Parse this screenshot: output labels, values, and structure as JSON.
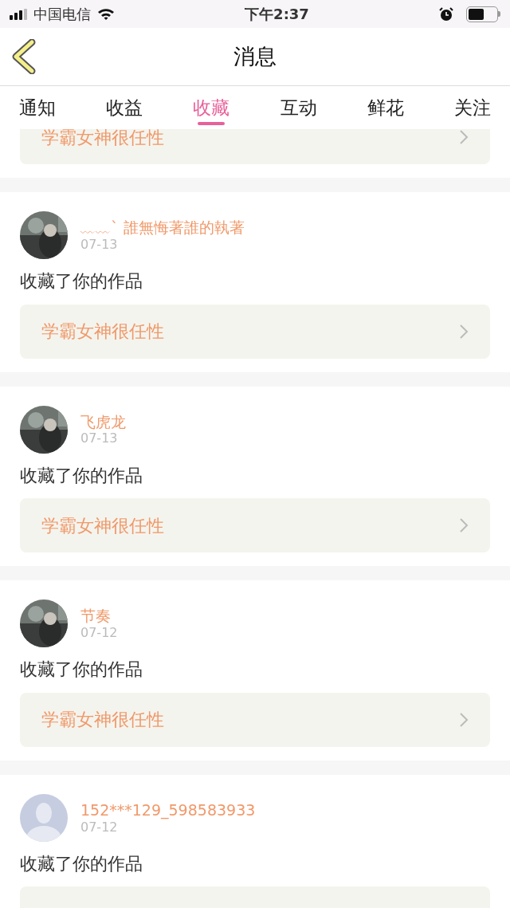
{
  "status_bar": {
    "carrier": "中国电信",
    "time": "下午2:37"
  },
  "nav": {
    "title": "消息"
  },
  "tabs": [
    {
      "label": "通知",
      "selected": false
    },
    {
      "label": "收益",
      "selected": false
    },
    {
      "label": "收藏",
      "selected": true
    },
    {
      "label": "互动",
      "selected": false
    },
    {
      "label": "鲜花",
      "selected": false
    },
    {
      "label": "关注",
      "selected": false
    }
  ],
  "partial_item": {
    "work_title": "学霸女神很任性"
  },
  "items": [
    {
      "name": "﹏﹏ˋ  誰無悔著誰的執著",
      "date": "07-13",
      "action": "收藏了你的作品",
      "work_title": "学霸女神很任性"
    },
    {
      "name": "飞虎龙",
      "date": "07-13",
      "action": "收藏了你的作品",
      "work_title": "学霸女神很任性"
    },
    {
      "name": "节奏",
      "date": "07-12",
      "action": "收藏了你的作品",
      "work_title": "学霸女神很任性"
    },
    {
      "avatar": {
        "kind": "default"
      },
      "name": "152***129_598583933",
      "date": "07-12",
      "action": "收藏了你的作品"
    }
  ]
}
